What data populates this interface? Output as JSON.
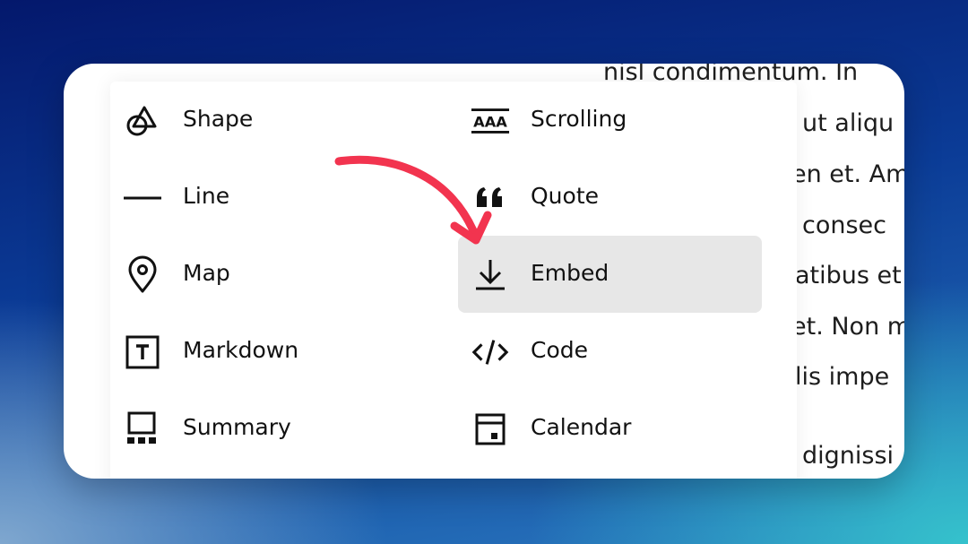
{
  "background_text": [
    "nisl condimentum. In",
    "ut aliqu",
    "en et. Am",
    "consec",
    "atibus et",
    "et. Non m",
    "lis impe",
    "dignissi"
  ],
  "menu": {
    "items": [
      {
        "label": "Shape",
        "icon": "shape-icon"
      },
      {
        "label": "Scrolling",
        "icon": "scrolling-text-icon"
      },
      {
        "label": "Line",
        "icon": "line-icon"
      },
      {
        "label": "Quote",
        "icon": "quote-icon"
      },
      {
        "label": "Map",
        "icon": "map-pin-icon"
      },
      {
        "label": "Embed",
        "icon": "embed-download-icon",
        "highlighted": true
      },
      {
        "label": "Markdown",
        "icon": "markdown-icon"
      },
      {
        "label": "Code",
        "icon": "code-icon"
      },
      {
        "label": "Summary",
        "icon": "summary-icon"
      },
      {
        "label": "Calendar",
        "icon": "calendar-icon"
      }
    ]
  },
  "colors": {
    "arrow": "#f2344f",
    "highlight": "#e7e7e7",
    "text": "#111111"
  }
}
